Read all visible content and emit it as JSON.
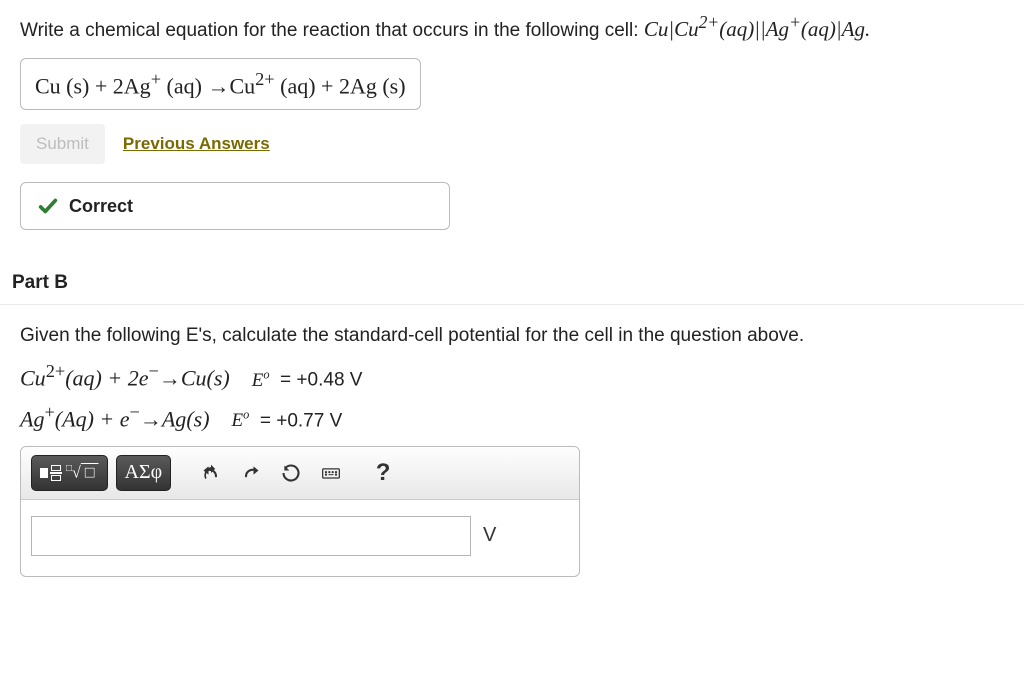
{
  "partA": {
    "prompt_prefix": "Write a chemical equation for the reaction that occurs in the following cell: ",
    "cell_notation": "Cu|Cu²⁺(aq)||Ag⁺(aq)|Ag.",
    "answer_equation": "Cu (s) + 2Ag⁺ (aq) → Cu²⁺ (aq) + 2Ag (s)",
    "submit_label": "Submit",
    "previous_answers_label": "Previous Answers",
    "correct_label": "Correct"
  },
  "partB": {
    "header": "Part B",
    "prompt": "Given the following E's, calculate the standard-cell potential for the cell in the question above.",
    "eq1_lhs": "Cu²⁺(aq) + 2e⁻ → Cu(s)",
    "eq1_eo": "Eº  = +0.48 V",
    "eq2_lhs": "Ag⁺(Aq) + e⁻ → Ag(s)",
    "eq2_eo": "Eº  = +0.77 V",
    "toolbar": {
      "templates_label": "templates",
      "greek_label": "ΑΣφ",
      "undo_label": "undo",
      "redo_label": "redo",
      "reset_label": "reset",
      "keyboard_label": "keyboard",
      "help_label": "?"
    },
    "answer_value": "",
    "unit": "V"
  }
}
